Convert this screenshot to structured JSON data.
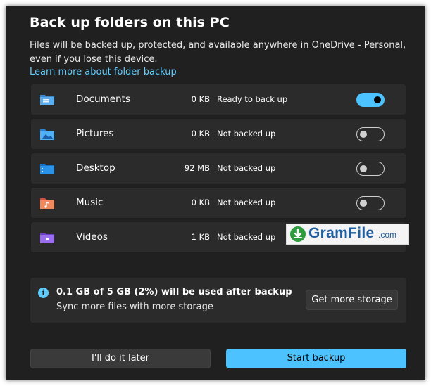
{
  "dialog": {
    "title": "Back up folders on this PC",
    "description": "Files will be backed up, protected, and available anywhere in OneDrive - Personal, even if you lose this device.",
    "learn_more": "Learn more about folder backup"
  },
  "folders": [
    {
      "name": "Documents",
      "size": "0 KB",
      "status": "Ready to back up",
      "enabled": true,
      "icon": "documents-folder-icon",
      "color": "#4a9fe0"
    },
    {
      "name": "Pictures",
      "size": "0 KB",
      "status": "Not backed up",
      "enabled": false,
      "icon": "pictures-folder-icon",
      "color": "#3aa0e8"
    },
    {
      "name": "Desktop",
      "size": "92 MB",
      "status": "Not backed up",
      "enabled": false,
      "icon": "desktop-folder-icon",
      "color": "#1f8ee0"
    },
    {
      "name": "Music",
      "size": "0 KB",
      "status": "Not backed up",
      "enabled": false,
      "icon": "music-folder-icon",
      "color": "#e8734a"
    },
    {
      "name": "Videos",
      "size": "1 KB",
      "status": "Not backed up",
      "enabled": false,
      "icon": "videos-folder-icon",
      "color": "#8b5ce0"
    }
  ],
  "watermark": {
    "text": "GramFile",
    "suffix": ".com"
  },
  "storage_info": {
    "main": "0.1 GB of 5 GB (2%) will be used after backup",
    "sub": "Sync more files with more storage",
    "button": "Get more storage",
    "icon": "info-icon"
  },
  "actions": {
    "later": "I'll do it later",
    "start": "Start backup"
  },
  "colors": {
    "background": "#202020",
    "row": "#2b2b2b",
    "accent": "#4cc2ff",
    "link": "#60cdff"
  }
}
